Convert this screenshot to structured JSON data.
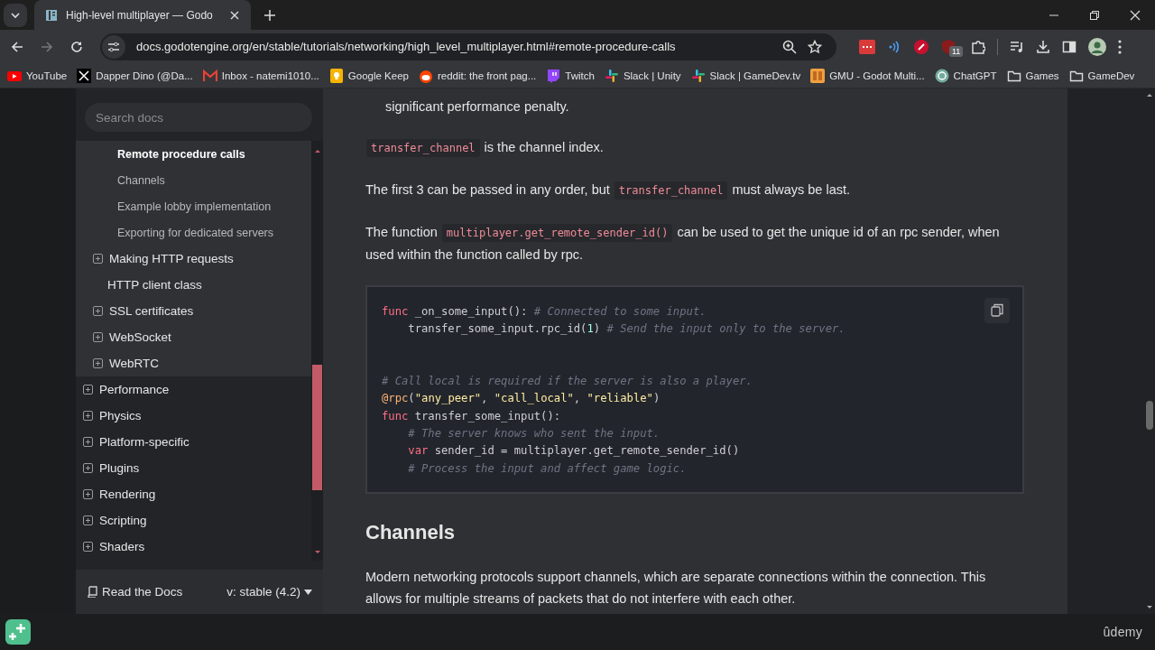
{
  "browser": {
    "tab": {
      "title": "High-level multiplayer — Godo",
      "selected": true
    },
    "address_bar": {
      "url": "docs.godotengine.org/en/stable/tutorials/networking/high_level_multiplayer.html#remote-procedure-calls"
    },
    "extension_badge": "11",
    "bookmarks": [
      {
        "kind": "youtube",
        "label": "YouTube"
      },
      {
        "kind": "x",
        "label": "Dapper Dino (@Da..."
      },
      {
        "kind": "mail",
        "label": "Inbox - natemi1010..."
      },
      {
        "kind": "keep",
        "label": "Google Keep"
      },
      {
        "kind": "round",
        "label": "reddit: the front pag..."
      },
      {
        "kind": "bubble",
        "label": "Twitch"
      },
      {
        "kind": "pinwheel",
        "label": "Slack | Unity"
      },
      {
        "kind": "pinwheel",
        "label": "Slack | GameDev.tv"
      },
      {
        "kind": "square",
        "label": "GMU - Godot Multi..."
      },
      {
        "kind": "knot",
        "label": "ChatGPT"
      },
      {
        "kind": "folder",
        "label": "Games"
      },
      {
        "kind": "folder",
        "label": "GameDev"
      }
    ]
  },
  "sidebar": {
    "search": {
      "placeholder": "Search docs"
    },
    "tree": [
      {
        "children": [
          {
            "children": [
              {
                "label": "Remote procedure calls",
                "expandable": false,
                "selected": true
              },
              {
                "label": "Channels",
                "expandable": false,
                "selected": false
              },
              {
                "label": "Example lobby implementation",
                "expandable": false,
                "selected": false
              },
              {
                "label": "Exporting for dedicated servers",
                "expandable": false,
                "selected": false
              }
            ]
          },
          {
            "label": "Making HTTP requests",
            "expandable": true,
            "selected": false
          },
          {
            "label": "HTTP client class",
            "expandable": false,
            "selected": false
          },
          {
            "label": "SSL certificates",
            "expandable": true,
            "selected": false
          },
          {
            "label": "WebSocket",
            "expandable": true,
            "selected": false
          },
          {
            "label": "WebRTC",
            "expandable": true,
            "selected": false
          }
        ]
      },
      {
        "label": "Performance",
        "expandable": true,
        "selected": false
      },
      {
        "label": "Physics",
        "expandable": true,
        "selected": false
      },
      {
        "label": "Platform-specific",
        "expandable": true,
        "selected": false
      },
      {
        "label": "Plugins",
        "expandable": true,
        "selected": false
      },
      {
        "label": "Rendering",
        "expandable": true,
        "selected": false
      },
      {
        "label": "Scripting",
        "expandable": true,
        "selected": false
      },
      {
        "label": "Shaders",
        "expandable": true,
        "selected": false
      }
    ],
    "footer": {
      "label": "Read the Docs",
      "version": "v: stable (4.2)"
    }
  },
  "content": [
    {
      "kind": "continuation",
      "segments": [
        {
          "kind": "text",
          "text": "significant performance penalty."
        }
      ]
    },
    {
      "kind": "paragraph",
      "segments": [
        {
          "kind": "code",
          "text": "transfer_channel"
        },
        {
          "kind": "text",
          "text": " is the channel index."
        }
      ]
    },
    {
      "kind": "paragraph",
      "segments": [
        {
          "kind": "text",
          "text": "The first 3 can be passed in any order, but "
        },
        {
          "kind": "code",
          "text": "transfer_channel"
        },
        {
          "kind": "text",
          "text": " must always be last."
        }
      ]
    },
    {
      "kind": "paragraph",
      "segments": [
        {
          "kind": "text",
          "text": "The function "
        },
        {
          "kind": "code",
          "text": "multiplayer.get_remote_sender_id()"
        },
        {
          "kind": "text",
          "text": " can be used to get the unique id of an rpc sender, when used within the function called by rpc."
        }
      ]
    },
    {
      "kind": "code",
      "lines": [
        {
          "kind": "code",
          "indent": false,
          "tokens": [
            {
              "kind": "keyword",
              "text": "func"
            },
            {
              "kind": "plain",
              "text": " _on_some_input(): "
            },
            {
              "kind": "comment",
              "text": "# Connected to some input."
            }
          ]
        },
        {
          "kind": "code",
          "indent": true,
          "tokens": [
            {
              "kind": "plain",
              "text": "transfer_some_input.rpc_id("
            },
            {
              "kind": "number",
              "text": "1"
            },
            {
              "kind": "plain",
              "text": ") "
            },
            {
              "kind": "comment",
              "text": "# Send the input only to the server."
            }
          ]
        },
        {
          "kind": "blank"
        },
        {
          "kind": "blank"
        },
        {
          "kind": "code",
          "indent": false,
          "tokens": [
            {
              "kind": "comment",
              "text": "# Call local is required if the server is also a player."
            }
          ]
        },
        {
          "kind": "code",
          "indent": false,
          "tokens": [
            {
              "kind": "annotation",
              "text": "@rpc"
            },
            {
              "kind": "plain",
              "text": "("
            },
            {
              "kind": "string",
              "text": "\"any_peer\""
            },
            {
              "kind": "plain",
              "text": ", "
            },
            {
              "kind": "string",
              "text": "\"call_local\""
            },
            {
              "kind": "plain",
              "text": ", "
            },
            {
              "kind": "string",
              "text": "\"reliable\""
            },
            {
              "kind": "plain",
              "text": ")"
            }
          ]
        },
        {
          "kind": "code",
          "indent": false,
          "tokens": [
            {
              "kind": "keyword",
              "text": "func"
            },
            {
              "kind": "plain",
              "text": " transfer_some_input():"
            }
          ]
        },
        {
          "kind": "code",
          "indent": true,
          "tokens": [
            {
              "kind": "comment",
              "text": "# The server knows who sent the input."
            }
          ]
        },
        {
          "kind": "code",
          "indent": true,
          "tokens": [
            {
              "kind": "keyword",
              "text": "var"
            },
            {
              "kind": "plain",
              "text": " sender_id = multiplayer.get_remote_sender_id()"
            }
          ]
        },
        {
          "kind": "code",
          "indent": true,
          "tokens": [
            {
              "kind": "comment",
              "text": "# Process the input and affect game logic."
            }
          ]
        }
      ]
    },
    {
      "kind": "heading",
      "text": "Channels"
    },
    {
      "kind": "paragraph",
      "segments": [
        {
          "kind": "text",
          "text": "Modern networking protocols support channels, which are separate connections within the connection. This allows for multiple streams of packets that do not interfere with each other."
        }
      ]
    }
  ],
  "player_bar": {
    "logo": "ûdemy"
  }
}
